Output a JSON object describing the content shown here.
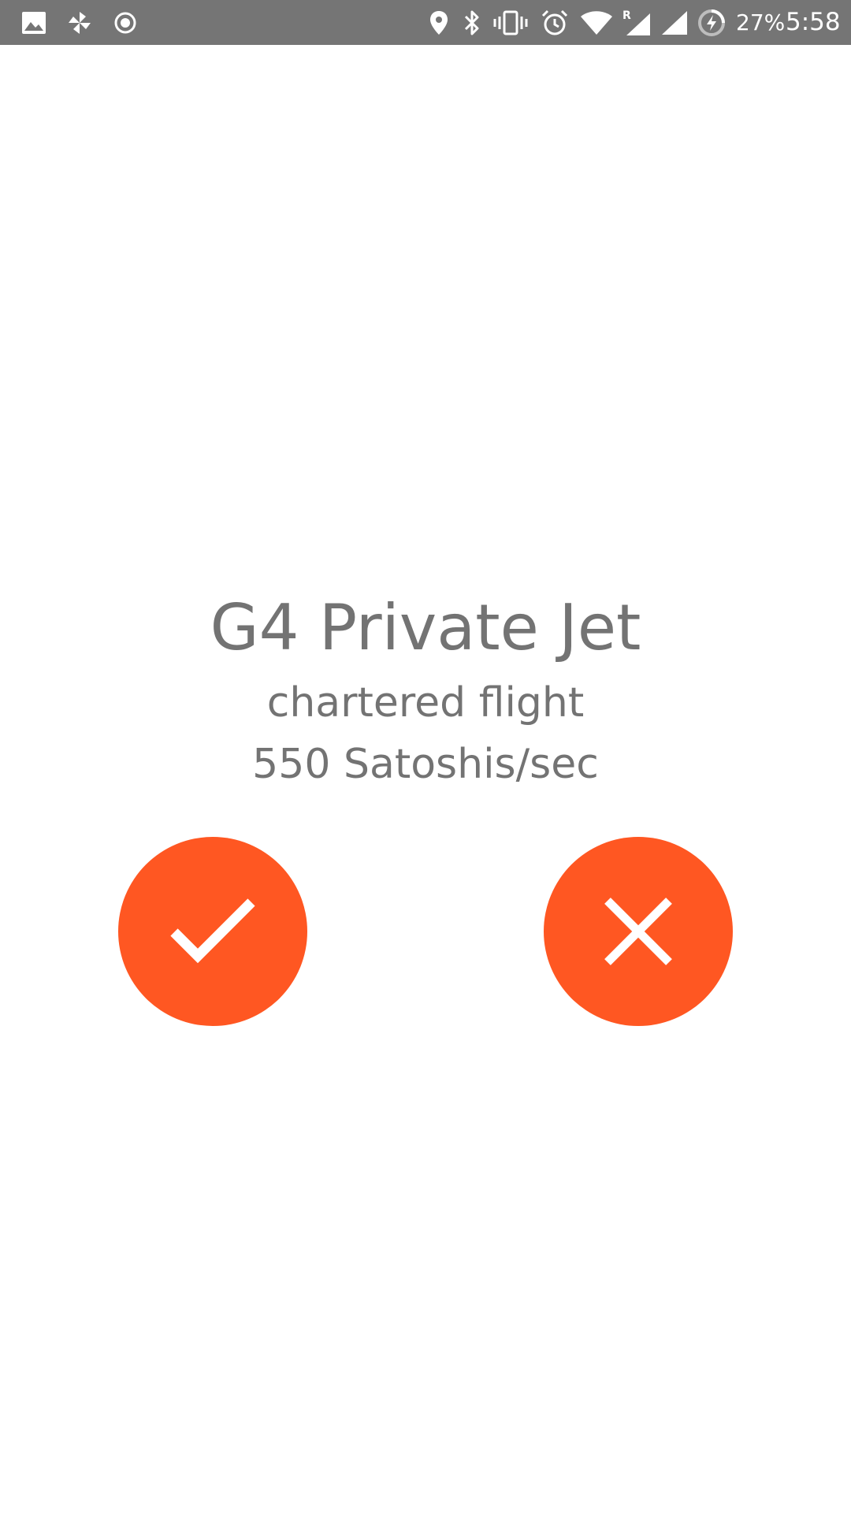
{
  "status_bar": {
    "icons_left": [
      "gallery-icon",
      "pinwheel-icon",
      "record-icon"
    ],
    "icons_right": [
      "location-icon",
      "bluetooth-icon",
      "vibrate-icon",
      "alarm-icon",
      "wifi-icon",
      "signal-roaming-icon",
      "signal-icon",
      "battery-charging-icon"
    ],
    "roaming_letter": "R",
    "battery_percent": "27%",
    "time": "5:58"
  },
  "offer": {
    "title": "G4 Private Jet",
    "subtitle": "chartered flight",
    "rate": "550 Satoshis/sec"
  },
  "actions": {
    "accept_icon": "checkmark-icon",
    "reject_icon": "close-icon"
  },
  "colors": {
    "accent": "#ff5722",
    "text": "#737373",
    "status_bar": "#757575"
  }
}
